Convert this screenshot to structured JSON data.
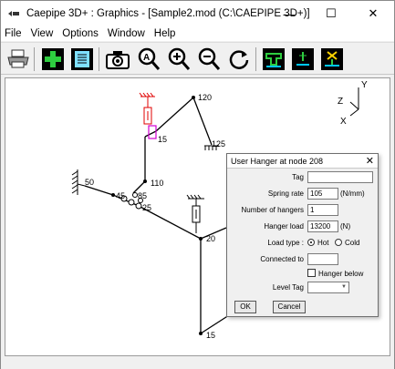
{
  "window": {
    "title": "Caepipe 3D+ : Graphics -   [Sample2.mod (C:\\CAEPIPE 3D+)]",
    "minimize_glyph": "—",
    "maximize_glyph": "☐",
    "close_glyph": "✕"
  },
  "menu": [
    "File",
    "View",
    "Options",
    "Window",
    "Help"
  ],
  "toolbar": {
    "buttons": [
      "print-icon",
      "add-icon",
      "notes-icon",
      "camera-icon",
      "zoom-window-icon",
      "zoom-in-icon",
      "zoom-out-icon",
      "redraw-icon",
      "view-option-1-icon",
      "view-option-2-icon",
      "view-option-3-icon"
    ]
  },
  "graphics": {
    "node_labels": {
      "n120": "120",
      "n15a": "15",
      "n125": "125",
      "n50": "50",
      "n110": "110",
      "n45": "45",
      "n85": "85",
      "n25": "25",
      "n20": "20",
      "n15b": "15"
    },
    "axes": {
      "y": "Y",
      "z": "Z",
      "x": "X"
    },
    "colors": {
      "hanger_red": "#e00000",
      "hanger_magenta": "#d000d0",
      "pipe": "#000000"
    }
  },
  "dialog": {
    "title": "User Hanger at node 208",
    "close_glyph": "✕",
    "tag_label": "Tag",
    "tag_value": "",
    "spring_rate_label": "Spring rate",
    "spring_rate_value": "105",
    "spring_rate_unit": "(N/mm)",
    "num_hangers_label": "Number of hangers",
    "num_hangers_value": "1",
    "hanger_load_label": "Hanger load",
    "hanger_load_value": "13200",
    "hanger_load_unit": "(N)",
    "load_type_label": "Load type :",
    "hot_label": "Hot",
    "cold_label": "Cold",
    "load_type_selected": "Hot",
    "connected_to_label": "Connected to",
    "connected_to_value": "",
    "hanger_below_label": "Hanger below",
    "hanger_below_checked": false,
    "level_tag_label": "Level Tag",
    "level_tag_value": "",
    "ok_label": "OK",
    "cancel_label": "Cancel"
  }
}
